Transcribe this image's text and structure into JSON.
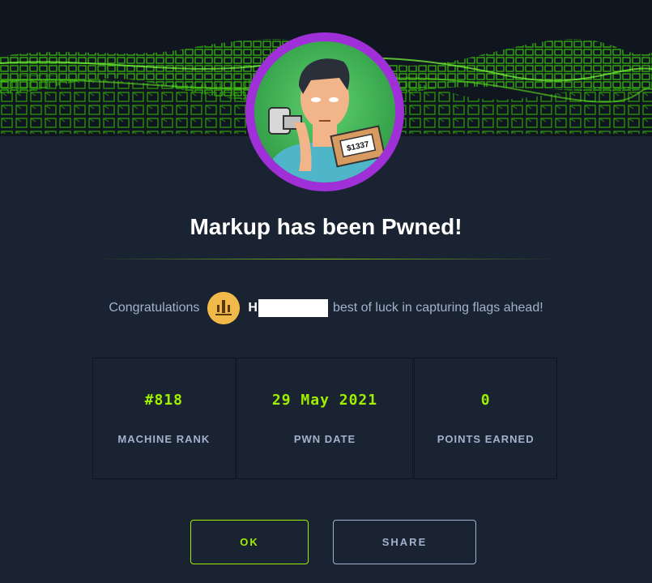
{
  "title": "Markup has been Pwned!",
  "congrats": {
    "prefix": "Congratulations",
    "username_initial": "H",
    "suffix": "best of luck in capturing flags ahead!"
  },
  "avatar": {
    "price_tag": "$1337"
  },
  "stats": [
    {
      "value": "#818",
      "label": "MACHINE RANK"
    },
    {
      "value": "29 May 2021",
      "label": "PWN DATE"
    },
    {
      "value": "0",
      "label": "POINTS EARNED"
    }
  ],
  "buttons": {
    "ok": "OK",
    "share": "SHARE"
  },
  "colors": {
    "background": "#1a2332",
    "accent_green": "#9fef00",
    "ring_purple": "#9f2fd6",
    "muted_text": "#a4b1cd"
  }
}
